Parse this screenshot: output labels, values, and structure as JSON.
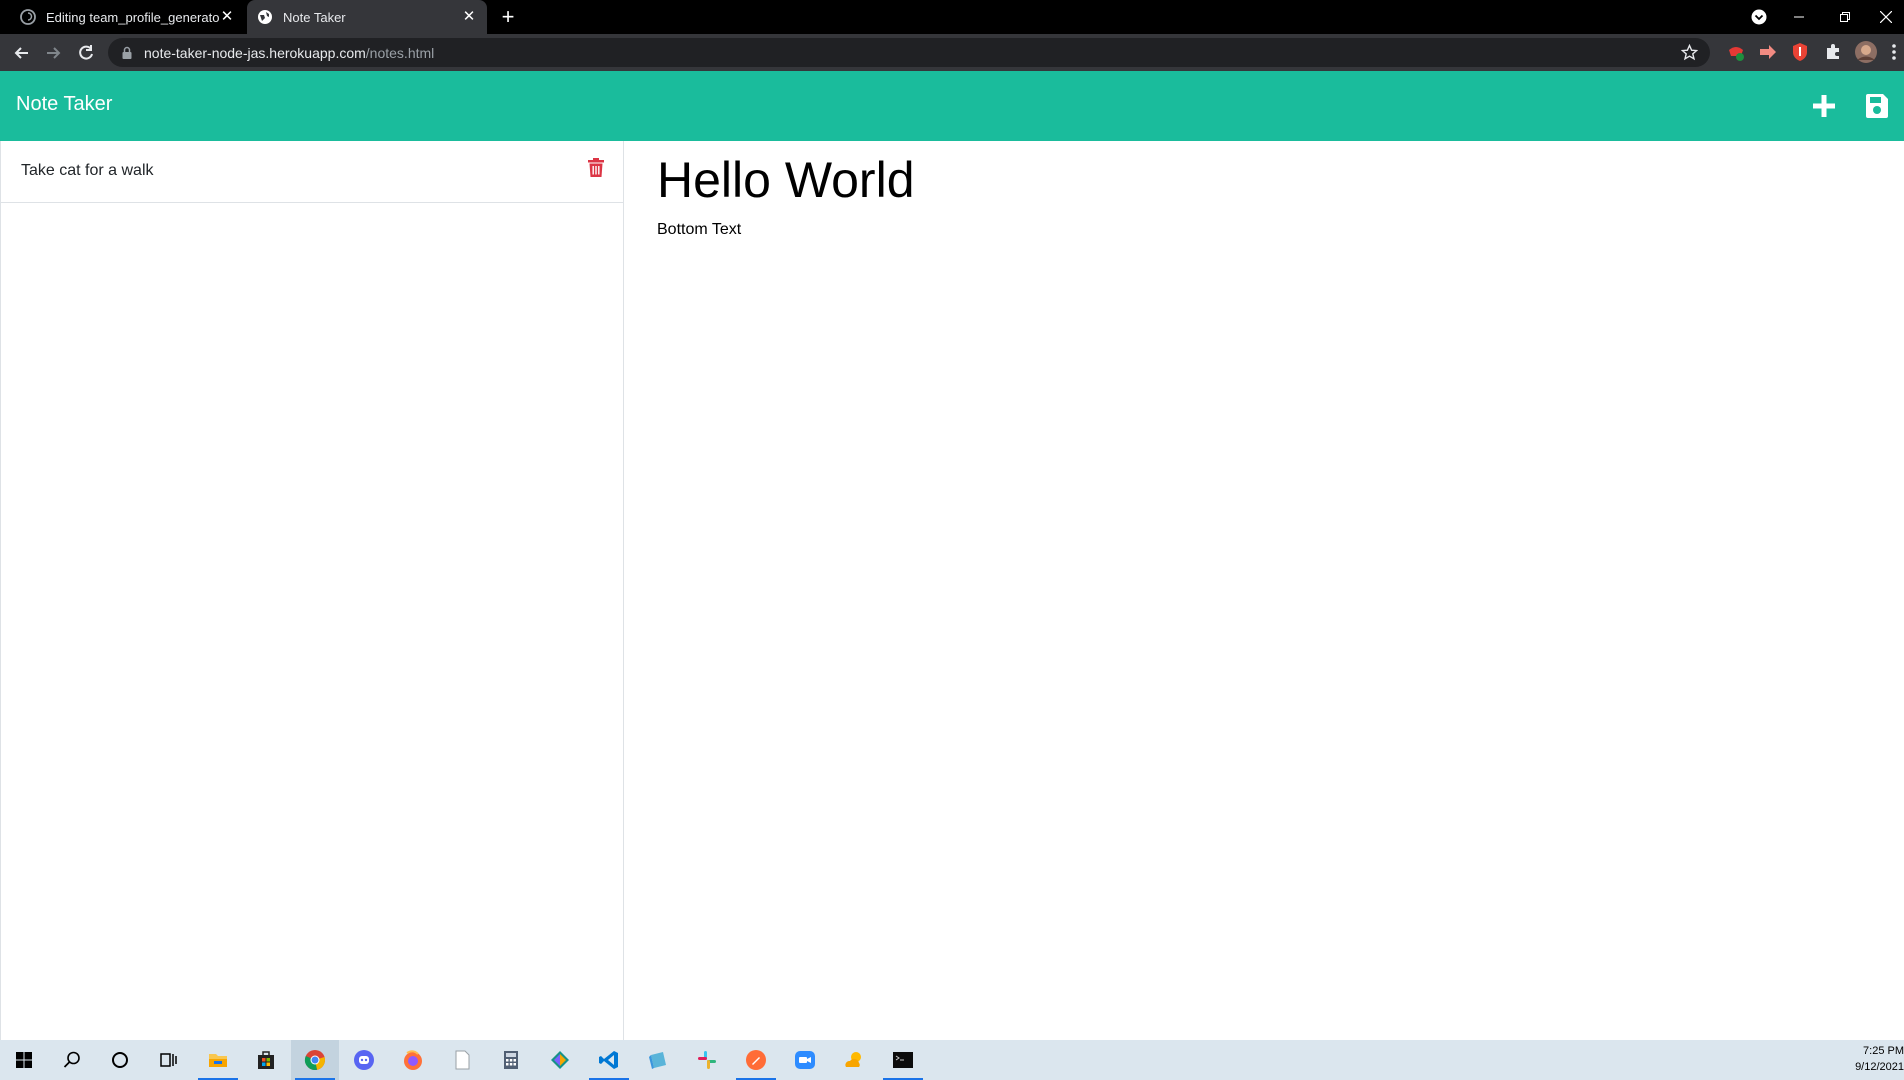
{
  "browser": {
    "tabs": [
      {
        "title": "Editing team_profile_generator/R",
        "favicon": "github-icon",
        "active": false
      },
      {
        "title": "Note Taker",
        "favicon": "globe-icon",
        "active": true
      }
    ],
    "new_tab_label": "+",
    "close_glyph": "✕",
    "url": {
      "host": "note-taker-node-jas.herokuapp.com",
      "path": "/notes.html"
    }
  },
  "app": {
    "brand": "Note Taker",
    "header_icons": [
      "plus-icon",
      "save-icon"
    ],
    "accent_color": "#1abc9c",
    "delete_color": "#dc3545"
  },
  "notes": [
    {
      "title": "Take cat for a walk"
    }
  ],
  "active_note": {
    "title": "Hello World",
    "text": "Bottom Text"
  },
  "taskbar": {
    "apps": [
      "start-icon",
      "search-icon",
      "cortana-icon",
      "task-view-icon",
      "file-explorer-icon",
      "store-icon",
      "chrome-icon",
      "discord-icon",
      "firefox-icon",
      "notepad-icon",
      "calculator-icon",
      "gitkraken-icon",
      "vscode-icon",
      "azure-storage-icon",
      "slack-icon",
      "postman-icon",
      "zoom-icon",
      "weather-icon",
      "terminal-icon"
    ],
    "time": "7:25 PM",
    "date": "9/12/2021"
  }
}
